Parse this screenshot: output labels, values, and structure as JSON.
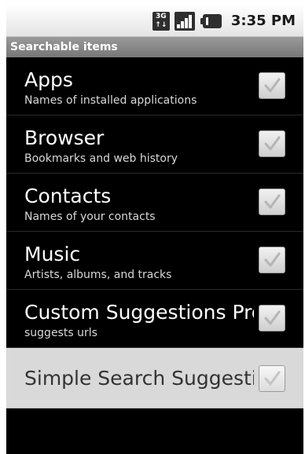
{
  "status_bar": {
    "network_badge_top": "3G",
    "network_badge_bottom": "↑↓",
    "time": "3:35 PM",
    "icons": [
      "network-3g-icon",
      "signal-strength-icon",
      "battery-icon"
    ]
  },
  "title_bar": {
    "title": "Searchable items"
  },
  "items": [
    {
      "title": "Apps",
      "summary": "Names of installed applications",
      "checked": true
    },
    {
      "title": "Browser",
      "summary": "Bookmarks and web history",
      "checked": true
    },
    {
      "title": "Contacts",
      "summary": "Names of your contacts",
      "checked": true
    },
    {
      "title": "Music",
      "summary": "Artists, albums, and tracks",
      "checked": true
    },
    {
      "title": "Custom Suggestions Prov",
      "summary": "suggests urls",
      "checked": true
    },
    {
      "title": "Simple Search Suggestio",
      "summary": "",
      "checked": true,
      "highlighted": true
    }
  ],
  "colors": {
    "background": "#000000",
    "title_bar": "#888888",
    "highlight": "#d9d9d9",
    "check_mark": "#b5b5b5"
  }
}
